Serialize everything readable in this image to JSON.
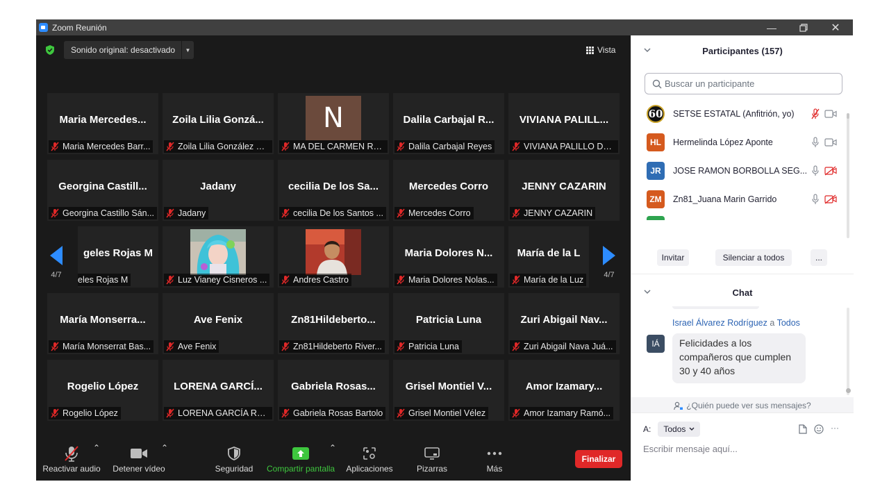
{
  "window": {
    "title": "Zoom Reunión"
  },
  "meeting": {
    "sound_label": "Sonido original: desactivado",
    "view_label": "Vista",
    "page_indicator": "4/7",
    "tiles": [
      {
        "big": "Maria  Mercedes...",
        "label": "Maria Mercedes Barr..."
      },
      {
        "big": "Zoila  Lilia  Gonzá...",
        "label": "Zoila Lilia González O..."
      },
      {
        "big": "",
        "avatar": "N",
        "label": "MA DEL CARMEN RO..."
      },
      {
        "big": "Dalila  Carbajal  R...",
        "label": "Dalila Carbajal Reyes"
      },
      {
        "big": "VIVIANA  PALILL...",
        "label": "VIVIANA PALILLO DO..."
      },
      {
        "big": "Georgina  Castill...",
        "label": "Georgina Castillo Sán..."
      },
      {
        "big": "Jadany",
        "label": "Jadany"
      },
      {
        "big": "cecilia  De  los  Sa...",
        "label": "cecilia De los Santos ..."
      },
      {
        "big": "Mercedes  Corro",
        "label": "Mercedes Corro"
      },
      {
        "big": "JENNY  CAZARIN",
        "label": "JENNY CAZARIN"
      },
      {
        "big": "geles Rojas M",
        "label": "eles Rojas M"
      },
      {
        "big": "",
        "photo": "photo-luz",
        "label": "Luz Vianey Cisneros ..."
      },
      {
        "big": "",
        "photo": "photo-andres",
        "label": "Andres Castro"
      },
      {
        "big": "Maria  Dolores  N...",
        "label": "Maria Dolores Nolas..."
      },
      {
        "big": "María  de  la  L",
        "label": "María de la Luz"
      },
      {
        "big": "María  Monserra...",
        "label": "María Monserrat Bas..."
      },
      {
        "big": "Ave  Fenix",
        "label": "Ave Fenix"
      },
      {
        "big": "Zn81Hildeberto...",
        "label": "Zn81Hildeberto River..."
      },
      {
        "big": "Patricia  Luna",
        "label": "Patricia Luna"
      },
      {
        "big": "Zuri  Abigail  Nav...",
        "label": "Zuri Abigail Nava Juá..."
      },
      {
        "big": "Rogelio  López",
        "label": "Rogelio López"
      },
      {
        "big": "LORENA  GARCÍ...",
        "label": "LORENA GARCÍA REY..."
      },
      {
        "big": "Gabriela  Rosas...",
        "label": "Gabriela Rosas Bartolo"
      },
      {
        "big": "Grisel  Montiel  V...",
        "label": "Grisel Montiel Vélez"
      },
      {
        "big": "Amor  Izamary...",
        "label": "Amor  Izamary Ramó..."
      }
    ]
  },
  "toolbar": {
    "audio": "Reactivar audio",
    "video": "Detener vídeo",
    "security": "Seguridad",
    "share": "Compartir pantalla",
    "apps": "Aplicaciones",
    "whiteboards": "Pizarras",
    "more": "Más",
    "end": "Finalizar"
  },
  "participants": {
    "header": "Participantes (157)",
    "search_placeholder": "Buscar un participante",
    "list": [
      {
        "initials": "60",
        "name": "SETSE ESTATAL (Anfitrión, yo)",
        "color": "#111111"
      },
      {
        "initials": "HL",
        "name": "Hermelinda López Aponte",
        "color": "#d55a1e"
      },
      {
        "initials": "JR",
        "name": "JOSE RAMON BORBOLLA SEG...",
        "color": "#2f6db4"
      },
      {
        "initials": "ZM",
        "name": "Zn81_Juana Marin Garrido",
        "color": "#d55a1e"
      }
    ],
    "invite": "Invitar",
    "mute_all": "Silenciar a todos",
    "more": "..."
  },
  "chat": {
    "header": "Chat",
    "sender": "Israel Álvarez Rodríguez",
    "to_word": "a",
    "recipient": "Todos",
    "sender_initials": "IÁ",
    "message_line1": "Felicidades a los",
    "message_line2": "compañeros que cumplen",
    "message_line3": "30 y 40 años",
    "who_sees": "¿Quién puede ver sus mensajes?",
    "to_label": "A:",
    "to_value": "Todos",
    "input_placeholder": "Escribir mensaje aquí...",
    "more": "···"
  },
  "colors": {
    "accent_green": "#3ec73e",
    "end_red": "#e02828",
    "mute_red": "#e02828",
    "link_blue": "#2d64b3",
    "nav_blue": "#2d8cff"
  }
}
